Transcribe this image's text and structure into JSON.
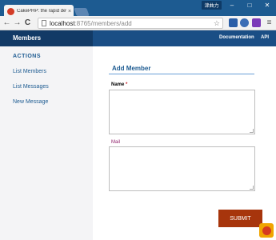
{
  "browser": {
    "tab_title": "CakePHP: the rapid devel",
    "tab_close": "×",
    "user_badge": "津曲力",
    "window_controls": {
      "minimize": "–",
      "maximize": "□",
      "close": "✕"
    },
    "nav": {
      "back": "←",
      "forward": "→",
      "reload": "C",
      "home": "⌂"
    },
    "url_host": "localhost",
    "url_path": ":8765/members/add",
    "star": "☆",
    "menu": "≡"
  },
  "header": {
    "title": "Members",
    "links": [
      "Documentation",
      "API"
    ]
  },
  "sidebar": {
    "heading": "ACTIONS",
    "links": [
      "List Members",
      "List Messages",
      "New Message"
    ]
  },
  "form": {
    "legend": "Add Member",
    "fields": [
      {
        "label": "Name",
        "required_marker": "*",
        "value": ""
      },
      {
        "label": "Mail",
        "value": ""
      }
    ],
    "submit_label": "SUBMIT"
  },
  "colors": {
    "accent": "#1d5b91",
    "submit": "#a7350c",
    "required": "#c3232d",
    "optional_label": "#8e1f6a"
  }
}
